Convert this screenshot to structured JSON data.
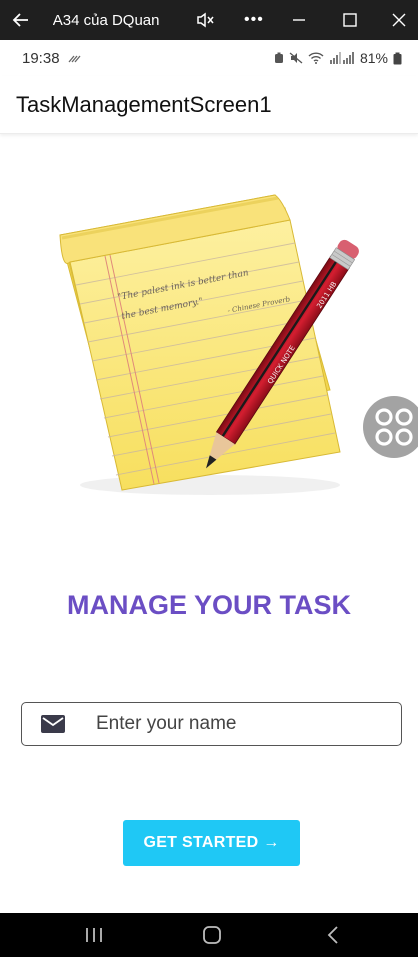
{
  "window": {
    "title": "A34 của DQuang",
    "icons": [
      "back-arrow-icon",
      "volume-mute-icon",
      "more-icon",
      "minimize-icon",
      "maximize-icon",
      "close-icon"
    ]
  },
  "status_bar": {
    "time": "19:38",
    "battery": "81%"
  },
  "app_bar": {
    "title": "TaskManagementScreen1"
  },
  "illustration": {
    "note_text_line1": "\"The palest ink is better than",
    "note_text_line2": "the best memory.\"",
    "note_attribution": "- Chinese Proverb",
    "pencil_brand": "QUICK NOTE",
    "pencil_grade": "2011 HB"
  },
  "main": {
    "headline": "MANAGE YOUR TASK",
    "name_field": {
      "value": "",
      "placeholder": "Enter your name"
    },
    "start_button": "GET STARTED →"
  },
  "colors": {
    "headline": "#6b4ec4",
    "button": "#1fc8f5",
    "note_paper": "#fbe77a",
    "pencil_body": "#c0182a"
  }
}
